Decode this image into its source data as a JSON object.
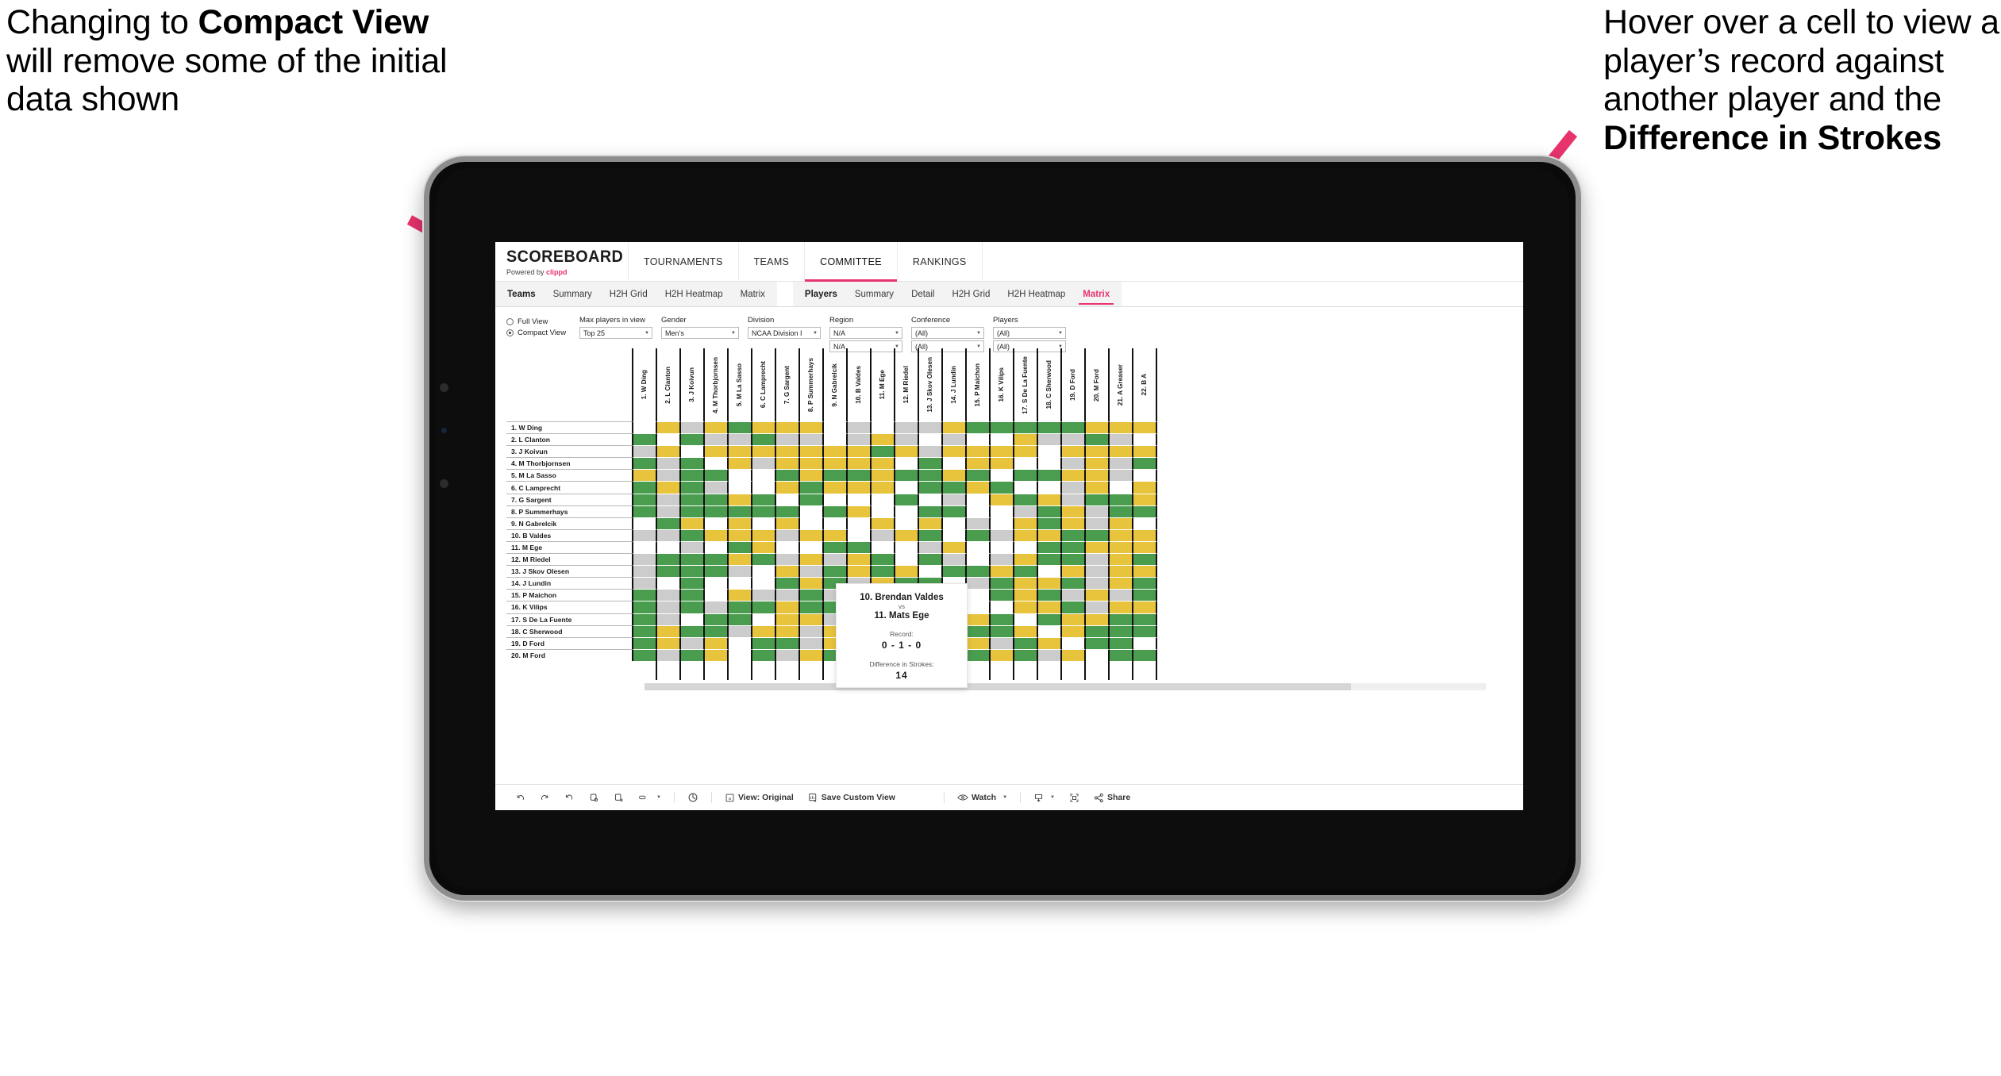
{
  "annotations": {
    "left": {
      "line1": "Changing to ",
      "bold": "Compact View",
      "line2": " will remove some of the initial data shown"
    },
    "right": {
      "line1": "Hover over a cell to view a player’s record against another player and the ",
      "bold": "Difference in Strokes"
    },
    "arrow_color": "#e8336d"
  },
  "app": {
    "brand": {
      "name": "SCOREBOARD",
      "powered_prefix": "Powered by ",
      "powered_brand": "clippd"
    },
    "topnav": [
      {
        "label": "TOURNAMENTS",
        "active": false
      },
      {
        "label": "TEAMS",
        "active": false
      },
      {
        "label": "COMMITTEE",
        "active": true
      },
      {
        "label": "RANKINGS",
        "active": false
      }
    ],
    "subnav_teams": [
      {
        "label": "Teams",
        "head": true,
        "active": false
      },
      {
        "label": "Summary",
        "head": false,
        "active": false
      },
      {
        "label": "H2H Grid",
        "head": false,
        "active": false
      },
      {
        "label": "H2H Heatmap",
        "head": false,
        "active": false
      },
      {
        "label": "Matrix",
        "head": false,
        "active": false
      }
    ],
    "subnav_players": [
      {
        "label": "Players",
        "head": true,
        "active": false
      },
      {
        "label": "Summary",
        "head": false,
        "active": false
      },
      {
        "label": "Detail",
        "head": false,
        "active": false
      },
      {
        "label": "H2H Grid",
        "head": false,
        "active": false
      },
      {
        "label": "H2H Heatmap",
        "head": false,
        "active": false
      },
      {
        "label": "Matrix",
        "head": false,
        "active": true
      }
    ],
    "filters": {
      "view_options": [
        {
          "label": "Full View",
          "selected": false
        },
        {
          "label": "Compact View",
          "selected": true
        }
      ],
      "max_players": {
        "label": "Max players in view",
        "value": "Top 25"
      },
      "gender": {
        "label": "Gender",
        "value": "Men’s"
      },
      "division": {
        "label": "Division",
        "value": "NCAA Division I"
      },
      "region": {
        "label": "Region",
        "value": "N/A",
        "value2": "N/A"
      },
      "conference": {
        "label": "Conference",
        "value": "(All)",
        "value2": "(All)"
      },
      "players": {
        "label": "Players",
        "value": "(All)",
        "value2": "(All)"
      }
    },
    "tooltip": {
      "player_a": "10. Brendan Valdes",
      "vs": "vs",
      "player_b": "11. Mats Ege",
      "record_label": "Record:",
      "record_value": "0 - 1 - 0",
      "strokes_label": "Difference in Strokes:",
      "strokes_value": "14"
    },
    "toolbar": {
      "view_label": "View: Original",
      "save_label": "Save Custom View",
      "watch_label": "Watch",
      "share_label": "Share"
    }
  },
  "chart_data": {
    "type": "heatmap",
    "title": "Players Head-to-Head Matrix",
    "xlabel": "",
    "ylabel": "",
    "legend": [
      {
        "key": "win",
        "color": "#4a9c4e",
        "label": "green"
      },
      {
        "key": "loss",
        "color": "#e8c33c",
        "label": "yellow"
      },
      {
        "key": "tie",
        "color": "#cccccc",
        "label": "grey"
      },
      {
        "key": "none",
        "color": "#ffffff",
        "label": "white"
      }
    ],
    "columns": [
      "1. W Ding",
      "2. L Clanton",
      "3. J Koivun",
      "4. M Thorbjornsen",
      "5. M La Sasso",
      "6. C Lamprecht",
      "7. G Sargent",
      "8. P Summerhays",
      "9. N Gabrelcik",
      "10. B Valdes",
      "11. M Ege",
      "12. M Riedel",
      "13. J Skov Olesen",
      "14. J Lundin",
      "15. P Maichon",
      "16. K Vilips",
      "17. S De La Fuente",
      "18. C Sherwood",
      "19. D Ford",
      "20. M Ford",
      "21. A Greaser",
      "22. B A"
    ],
    "rows": [
      "1. W Ding",
      "2. L Clanton",
      "3. J Koivun",
      "4. M Thorbjornsen",
      "5. M La Sasso",
      "6. C Lamprecht",
      "7. G Sargent",
      "8. P Summerhays",
      "9. N Gabrelcik",
      "10. B Valdes",
      "11. M Ege",
      "12. M Riedel",
      "13. J Skov Olesen",
      "14. J Lundin",
      "15. P Maichon",
      "16. K Vilips",
      "17. S De La Fuente",
      "18. C Sherwood",
      "19. D Ford",
      "20. M Ford"
    ],
    "matrix": [
      [
        "w",
        "y",
        "a",
        "y",
        "g",
        "y",
        "y",
        "y",
        "w",
        "a",
        "w",
        "a",
        "a",
        "y",
        "g",
        "g",
        "g",
        "g",
        "g",
        "y",
        "y",
        "y"
      ],
      [
        "g",
        "w",
        "g",
        "a",
        "a",
        "g",
        "a",
        "a",
        "w",
        "a",
        "y",
        "a",
        "w",
        "a",
        "w",
        "w",
        "y",
        "a",
        "a",
        "g",
        "a",
        "w"
      ],
      [
        "a",
        "y",
        "w",
        "y",
        "y",
        "y",
        "y",
        "y",
        "y",
        "y",
        "g",
        "y",
        "a",
        "y",
        "y",
        "y",
        "y",
        "w",
        "y",
        "y",
        "y",
        "y"
      ],
      [
        "g",
        "a",
        "g",
        "w",
        "y",
        "a",
        "y",
        "y",
        "y",
        "y",
        "y",
        "w",
        "g",
        "w",
        "y",
        "y",
        "w",
        "w",
        "a",
        "y",
        "a",
        "g"
      ],
      [
        "y",
        "a",
        "g",
        "g",
        "w",
        "w",
        "g",
        "y",
        "g",
        "g",
        "y",
        "g",
        "g",
        "y",
        "g",
        "w",
        "g",
        "g",
        "y",
        "y",
        "a",
        "w"
      ],
      [
        "g",
        "y",
        "g",
        "a",
        "w",
        "w",
        "y",
        "g",
        "y",
        "y",
        "y",
        "w",
        "g",
        "g",
        "y",
        "g",
        "w",
        "w",
        "a",
        "y",
        "w",
        "y"
      ],
      [
        "g",
        "a",
        "g",
        "g",
        "y",
        "g",
        "w",
        "g",
        "w",
        "w",
        "w",
        "g",
        "w",
        "a",
        "w",
        "y",
        "g",
        "y",
        "a",
        "g",
        "g",
        "y"
      ],
      [
        "g",
        "a",
        "g",
        "g",
        "g",
        "g",
        "g",
        "w",
        "g",
        "y",
        "w",
        "w",
        "g",
        "g",
        "w",
        "w",
        "a",
        "g",
        "y",
        "a",
        "g",
        "g"
      ],
      [
        "w",
        "g",
        "y",
        "w",
        "y",
        "w",
        "y",
        "w",
        "w",
        "w",
        "y",
        "w",
        "y",
        "w",
        "a",
        "w",
        "y",
        "g",
        "y",
        "a",
        "y",
        "w"
      ],
      [
        "a",
        "a",
        "g",
        "y",
        "y",
        "y",
        "a",
        "y",
        "y",
        "w",
        "a",
        "y",
        "g",
        "w",
        "g",
        "a",
        "y",
        "y",
        "g",
        "g",
        "y",
        "y"
      ],
      [
        "w",
        "w",
        "a",
        "w",
        "g",
        "y",
        "w",
        "w",
        "g",
        "g",
        "w",
        "w",
        "a",
        "y",
        "w",
        "w",
        "w",
        "g",
        "g",
        "y",
        "y",
        "y"
      ],
      [
        "a",
        "g",
        "g",
        "g",
        "y",
        "g",
        "a",
        "y",
        "a",
        "y",
        "g",
        "w",
        "g",
        "a",
        "w",
        "a",
        "y",
        "g",
        "g",
        "a",
        "y",
        "g"
      ],
      [
        "a",
        "g",
        "g",
        "g",
        "a",
        "w",
        "y",
        "a",
        "g",
        "y",
        "g",
        "y",
        "w",
        "g",
        "g",
        "y",
        "g",
        "w",
        "y",
        "a",
        "y",
        "y"
      ],
      [
        "a",
        "w",
        "g",
        "w",
        "w",
        "w",
        "g",
        "y",
        "g",
        "a",
        "y",
        "g",
        "g",
        "w",
        "a",
        "g",
        "y",
        "y",
        "g",
        "a",
        "y",
        "g"
      ],
      [
        "g",
        "a",
        "g",
        "w",
        "y",
        "a",
        "a",
        "g",
        "a",
        "a",
        "w",
        "g",
        "g",
        "a",
        "w",
        "g",
        "y",
        "g",
        "a",
        "y",
        "a",
        "g"
      ],
      [
        "g",
        "a",
        "g",
        "a",
        "g",
        "g",
        "y",
        "g",
        "g",
        "a",
        "w",
        "g",
        "g",
        "y",
        "w",
        "w",
        "y",
        "y",
        "g",
        "a",
        "y",
        "y"
      ],
      [
        "g",
        "a",
        "w",
        "g",
        "g",
        "w",
        "y",
        "y",
        "a",
        "y",
        "g",
        "w",
        "g",
        "g",
        "y",
        "g",
        "w",
        "g",
        "y",
        "y",
        "g",
        "g"
      ],
      [
        "g",
        "y",
        "g",
        "g",
        "a",
        "y",
        "y",
        "a",
        "y",
        "g",
        "g",
        "y",
        "a",
        "g",
        "g",
        "g",
        "y",
        "w",
        "y",
        "g",
        "g",
        "g"
      ],
      [
        "g",
        "y",
        "a",
        "y",
        "w",
        "g",
        "g",
        "a",
        "y",
        "g",
        "y",
        "g",
        "g",
        "y",
        "y",
        "a",
        "g",
        "y",
        "w",
        "g",
        "g",
        "w"
      ],
      [
        "g",
        "a",
        "g",
        "y",
        "w",
        "g",
        "a",
        "y",
        "g",
        "g",
        "g",
        "a",
        "g",
        "g",
        "g",
        "y",
        "g",
        "a",
        "y",
        "w",
        "g",
        "g"
      ]
    ]
  }
}
